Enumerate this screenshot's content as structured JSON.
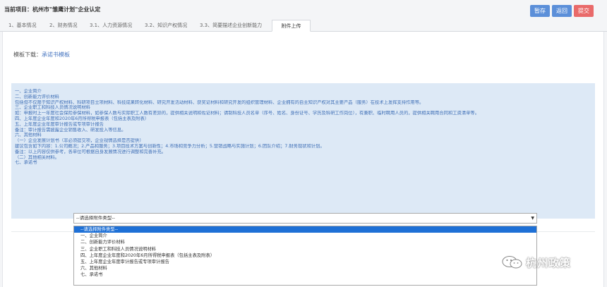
{
  "header": {
    "project_label": "当前项目：",
    "project_name": "杭州市\"雏鹰计划\"企业认定"
  },
  "toolbar": {
    "save_label": "暂存",
    "back_label": "返回",
    "submit_label": "提交",
    "colors": {
      "primary": "#5b8fd9",
      "danger": "#e96a6a"
    }
  },
  "tabs": [
    {
      "label": "1、基本情况"
    },
    {
      "label": "2、财务情况"
    },
    {
      "label": "3.1、人力资源情况"
    },
    {
      "label": "3.2、知识产权情况"
    },
    {
      "label": "3.3、简要描述企业创新能力"
    },
    {
      "label": "附件上传",
      "active": true
    }
  ],
  "template": {
    "label": "模板下载：",
    "link": "承诺书模板"
  },
  "info": {
    "lines": [
      "一、企业简介",
      "二、创新能力评价材料",
      "包括但不仅限于知识产权材料、科研项目立项材料、科技成果转化材料、研究开发活动材料、获奖证材料和研究开发的组织管理材料、企业拥有的自主知识产权对其主要产品（服务）在技术上发挥支持作用等。",
      "三、企业职工和科技人员情况说明材料",
      "如：申报时上一年度社会保险参保材料，如参保人数与实际职工人数有差异的，提供相关说明和佐证材料；请制科技人员名单（序号、姓名、身份证号、学历及科研工作岗位），有兼职、临时聘用人员的，提供相关聘用合同和工资清单等。",
      "四、上年度企业年度和2020年6月所得税申报表（包括主表及附表）",
      "五、上年度企业年度审计报告或专项审计报告",
      "备注：审计报告需披露企业销售收入、研发投入等信息。",
      "六、其他材料",
      "（一）企业发展计划书（非必须提交项，企业视情选择是否提供）",
      "建议包含如下内容：1.公司概况；2.产品和服务；3.项目技术方案与创新性；4.市场和竞争力分析；5.营销战略与实施计划；6.团队介绍；7.财务现状和计划。",
      "备注：以上内容仅供参考，各单位可根据自身发展情况进行调整和完善补充。",
      "（二）其他相关材料。",
      "七、承诺书"
    ]
  },
  "attachment_select": {
    "value": "--请选择附件类型--",
    "options": [
      "--请选择附件类型--",
      "一、企业简介",
      "二、创新能力评价材料",
      "三、企业职工和科技人员情况说明材料",
      "四、上年度企业年度和2020年6月所得税申报表（包括主表及附表）",
      "五、上年度企业年度审计报告或专项审计报告",
      "六、其他材料",
      "七、承诺书"
    ],
    "highlight_color": "#1e70d6"
  },
  "watermark": {
    "text": "杭州政策",
    "icon": "wechat-icon"
  }
}
